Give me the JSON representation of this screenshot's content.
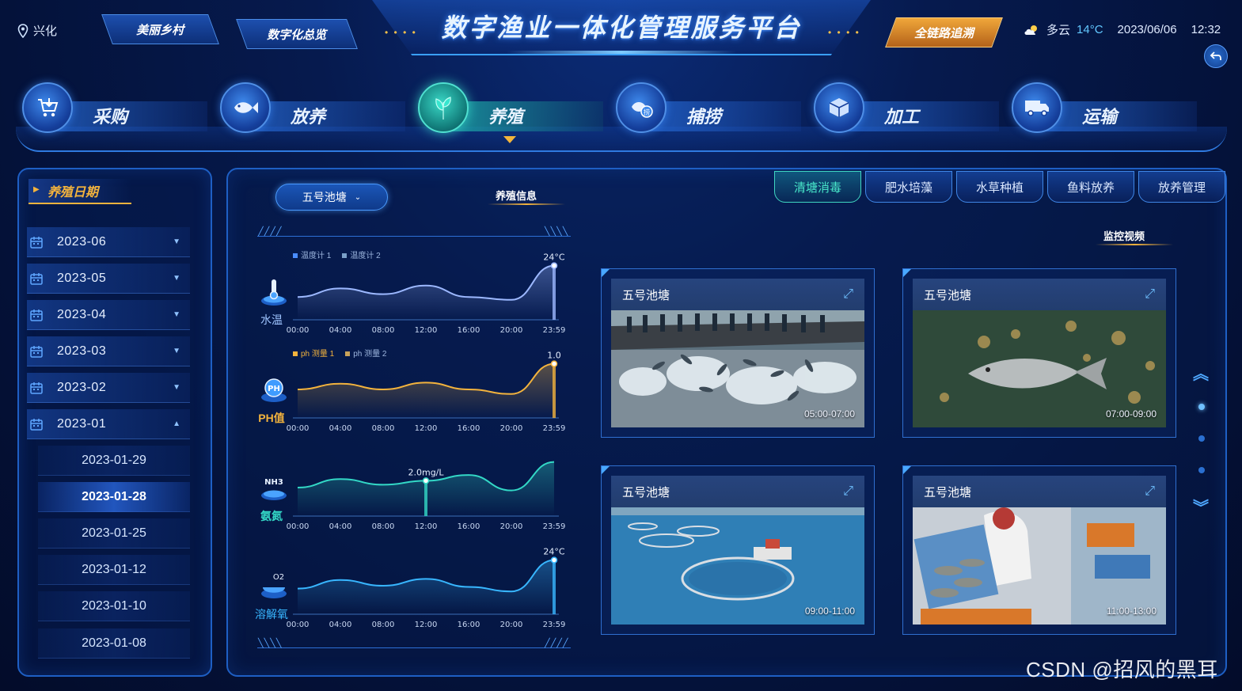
{
  "header": {
    "location": "兴化",
    "tabs": [
      "美丽乡村",
      "数字化总览"
    ],
    "title": "数字渔业一体化管理服务平台",
    "trace_tab": "全链路追溯",
    "weather": "多云",
    "temperature": "14°C",
    "date": "2023/06/06",
    "time": "12:32"
  },
  "nav": [
    {
      "label": "采购",
      "icon": "cart-icon"
    },
    {
      "label": "放养",
      "icon": "fish-icon"
    },
    {
      "label": "养殖",
      "icon": "leaf-icon",
      "active": true
    },
    {
      "label": "捕捞",
      "icon": "catch-icon"
    },
    {
      "label": "加工",
      "icon": "box-icon"
    },
    {
      "label": "运输",
      "icon": "truck-icon"
    }
  ],
  "left": {
    "title": "养殖日期",
    "months": [
      "2023-06",
      "2023-05",
      "2023-04",
      "2023-03",
      "2023-02",
      "2023-01"
    ],
    "days": [
      "2023-01-29",
      "2023-01-28",
      "2023-01-25",
      "2023-01-12",
      "2023-01-10",
      "2023-01-08"
    ],
    "active_day": "2023-01-28"
  },
  "main": {
    "pond": "五号池塘",
    "info_title": "养殖信息",
    "monitor_title": "监控视频",
    "tabs": [
      "清塘消毒",
      "肥水培藻",
      "水草种植",
      "鱼料放养",
      "放养管理"
    ],
    "active_tab": "清塘消毒"
  },
  "chart_data": [
    {
      "type": "line",
      "param": "水温",
      "series": [
        {
          "name": "温度计 1",
          "color": "#4a8dff"
        },
        {
          "name": "温度计 2",
          "color": "#7aa0c8"
        }
      ],
      "x": [
        "00:00",
        "04:00",
        "08:00",
        "12:00",
        "16:00",
        "20:00",
        "23:59"
      ],
      "values": [
        0.4,
        0.55,
        0.45,
        0.6,
        0.4,
        0.35,
        0.95
      ],
      "marker_label": "24°C",
      "color": "#9cb8ff"
    },
    {
      "type": "line",
      "param": "PH值",
      "series": [
        {
          "name": "ph 测量 1",
          "color": "#f3b33d"
        },
        {
          "name": "ph 测量 2",
          "color": "#c8a25a"
        }
      ],
      "x": [
        "00:00",
        "04:00",
        "08:00",
        "12:00",
        "16:00",
        "20:00",
        "23:59"
      ],
      "values": [
        0.5,
        0.6,
        0.5,
        0.62,
        0.5,
        0.42,
        0.95
      ],
      "marker_label": "1.0",
      "color": "#f3b33d"
    },
    {
      "type": "line",
      "param": "氨氮",
      "series": [],
      "x": [
        "00:00",
        "04:00",
        "08:00",
        "12:00",
        "16:00",
        "20:00",
        "23:59"
      ],
      "values": [
        0.5,
        0.65,
        0.55,
        0.62,
        0.72,
        0.45,
        0.95
      ],
      "marker_label": "2.0mg/L",
      "color": "#33d8c6"
    },
    {
      "type": "line",
      "param": "溶解氧",
      "series": [],
      "x": [
        "00:00",
        "04:00",
        "08:00",
        "12:00",
        "16:00",
        "20:00",
        "23:59"
      ],
      "values": [
        0.45,
        0.6,
        0.5,
        0.62,
        0.48,
        0.4,
        0.95
      ],
      "marker_label": "24°C",
      "color": "#38b6ff"
    }
  ],
  "videos": [
    {
      "title": "五号池塘",
      "time": "05:00-07:00",
      "scene": "fishermen-net"
    },
    {
      "title": "五号池塘",
      "time": "07:00-09:00",
      "scene": "underwater-fish"
    },
    {
      "title": "五号池塘",
      "time": "09:00-11:00",
      "scene": "sea-cage"
    },
    {
      "title": "五号池塘",
      "time": "11:00-13:00",
      "scene": "fish-basket"
    }
  ],
  "watermark": "CSDN @招风的黑耳"
}
